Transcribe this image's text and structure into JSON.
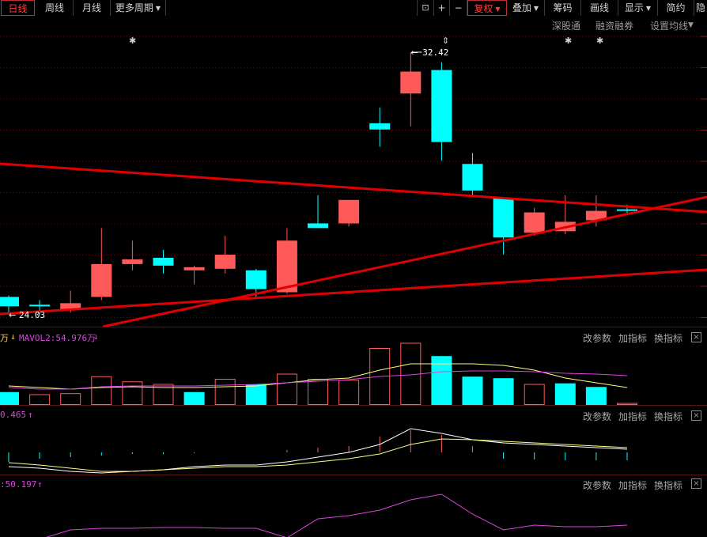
{
  "toolbar": {
    "tabs": [
      {
        "label": "日线",
        "active": true
      },
      {
        "label": "周线",
        "active": false
      },
      {
        "label": "月线",
        "active": false
      },
      {
        "label": "更多周期",
        "active": false,
        "dropdown": true
      }
    ],
    "right_buttons": [
      {
        "name": "lock",
        "label": "🔓"
      },
      {
        "name": "zoom-in",
        "label": "+"
      },
      {
        "name": "zoom-out",
        "label": "−"
      },
      {
        "name": "fuquan",
        "label": "复权",
        "dropdown": true,
        "accent": true
      },
      {
        "name": "overlay",
        "label": "叠加",
        "dropdown": true
      },
      {
        "name": "chips",
        "label": "筹码"
      },
      {
        "name": "draw",
        "label": "画线"
      },
      {
        "name": "display",
        "label": "显示",
        "dropdown": true
      },
      {
        "name": "simple",
        "label": "简约"
      }
    ]
  },
  "subbar": {
    "links": [
      "深股通",
      "融资融券",
      "设置均线"
    ]
  },
  "colors": {
    "up": "#ff5a5a",
    "down": "#00ffff",
    "trend": "#e00000",
    "grid": "#5a1414",
    "ma1": "#ffff80",
    "ma2": "#dd44dd"
  },
  "chart_data": {
    "type": "candlestick",
    "candles": [
      {
        "o": 24.6,
        "h": 24.65,
        "l": 24.03,
        "c": 24.3
      },
      {
        "o": 24.35,
        "h": 24.5,
        "l": 24.05,
        "c": 24.3
      },
      {
        "o": 24.2,
        "h": 24.8,
        "l": 24.1,
        "c": 24.4
      },
      {
        "o": 24.6,
        "h": 26.8,
        "l": 24.5,
        "c": 25.65
      },
      {
        "o": 25.65,
        "h": 26.4,
        "l": 25.45,
        "c": 25.8
      },
      {
        "o": 25.85,
        "h": 26.1,
        "l": 25.35,
        "c": 25.6
      },
      {
        "o": 25.45,
        "h": 25.6,
        "l": 25.0,
        "c": 25.55
      },
      {
        "o": 25.5,
        "h": 26.55,
        "l": 25.35,
        "c": 25.95
      },
      {
        "o": 25.45,
        "h": 25.5,
        "l": 24.55,
        "c": 24.85
      },
      {
        "o": 24.75,
        "h": 26.8,
        "l": 24.7,
        "c": 26.4
      },
      {
        "o": 26.95,
        "h": 27.85,
        "l": 26.85,
        "c": 26.8
      },
      {
        "o": 26.95,
        "h": 27.55,
        "l": 26.85,
        "c": 27.7
      },
      {
        "o": 30.15,
        "h": 30.65,
        "l": 29.4,
        "c": 29.95
      },
      {
        "o": 31.1,
        "h": 32.42,
        "l": 30.05,
        "c": 31.8
      },
      {
        "o": 31.85,
        "h": 32.1,
        "l": 28.95,
        "c": 29.55
      },
      {
        "o": 28.85,
        "h": 29.2,
        "l": 27.8,
        "c": 28.0
      },
      {
        "o": 27.75,
        "h": 27.75,
        "l": 25.95,
        "c": 26.5
      },
      {
        "o": 26.65,
        "h": 27.45,
        "l": 26.55,
        "c": 27.3
      },
      {
        "o": 26.7,
        "h": 27.85,
        "l": 26.6,
        "c": 27.0
      },
      {
        "o": 27.05,
        "h": 27.85,
        "l": 26.85,
        "c": 27.35
      },
      {
        "o": 27.4,
        "h": 27.55,
        "l": 27.25,
        "c": 27.35
      }
    ],
    "annotations": {
      "high": "32.42",
      "low": "24.03"
    },
    "volume": {
      "label": "MAVOL2:54.976万",
      "values": [
        25,
        20,
        22,
        55,
        45,
        40,
        25,
        50,
        40,
        60,
        50,
        48,
        110,
        120,
        95,
        55,
        52,
        40,
        42,
        35,
        3
      ],
      "colors_up": [
        false,
        true,
        true,
        true,
        true,
        true,
        false,
        true,
        false,
        true,
        true,
        true,
        true,
        true,
        false,
        false,
        false,
        true,
        false,
        false,
        true
      ]
    },
    "macd": {
      "label": "0.465"
    },
    "indicator3": {
      "label": ":50.197"
    }
  },
  "panel_buttons": [
    "改参数",
    "加指标",
    "换指标"
  ],
  "arrows": {
    "down": "↓",
    "up": "↑",
    "close": "×",
    "left": "万"
  }
}
